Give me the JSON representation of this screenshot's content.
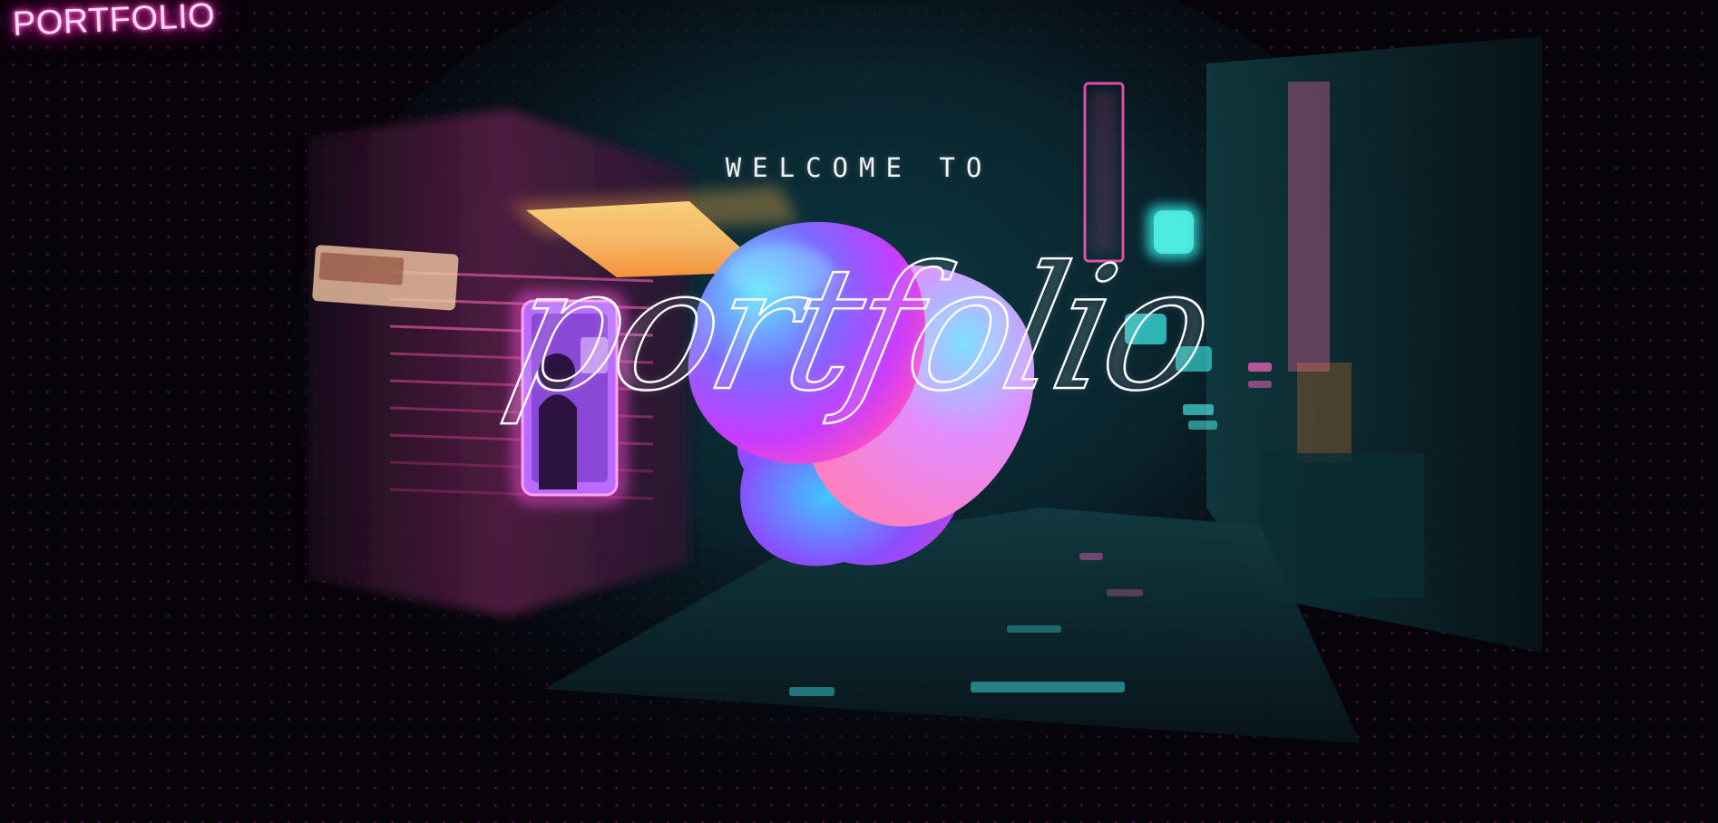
{
  "header": {
    "logo_text": "PORTFOLIO"
  },
  "hero": {
    "kicker": "WELCOME TO",
    "title": "portfolio",
    "background": "neon-alley-illustration",
    "focal_object": "iridescent-blob"
  },
  "colors": {
    "page_background": "#060309",
    "dot_grid": "#8e1a84",
    "logo_glow": "#ff3fbf",
    "text": "#ffffff"
  }
}
